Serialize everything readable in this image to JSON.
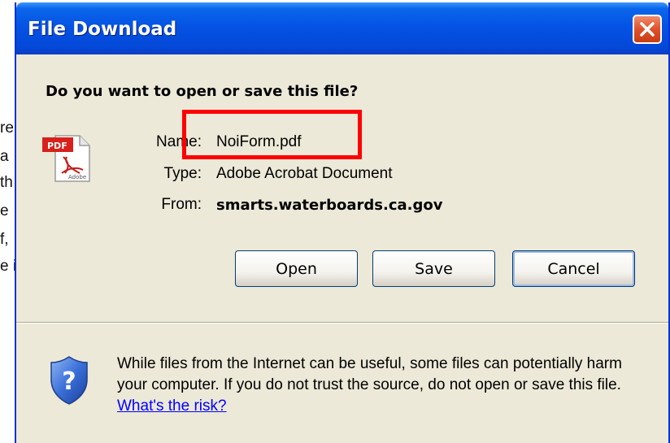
{
  "background_fragments": [
    "re",
    "a",
    "th",
    "e",
    "f,",
    "e i"
  ],
  "dialog": {
    "title": "File Download",
    "question": "Do you want to open or save this file?",
    "fields": {
      "name_label": "Name:",
      "name_value": "NoiForm.pdf",
      "type_label": "Type:",
      "type_value": "Adobe Acrobat Document",
      "from_label": "From:",
      "from_value": "smarts.waterboards.ca.gov"
    },
    "buttons": {
      "open": "Open",
      "save": "Save",
      "cancel": "Cancel"
    },
    "warning": {
      "text": "While files from the Internet can be useful, some files can potentially harm your computer. If you do not trust the source, do not open or save this file.",
      "link": "What's the risk?"
    }
  },
  "icons": {
    "file": "pdf-file-icon",
    "warning": "shield-question-icon",
    "close": "close-icon"
  },
  "colors": {
    "titlebar": "#0553e4",
    "dialog_bg": "#ece9d8",
    "close_button": "#e0502a",
    "highlight": "#ff0000",
    "link": "#0000ff"
  }
}
